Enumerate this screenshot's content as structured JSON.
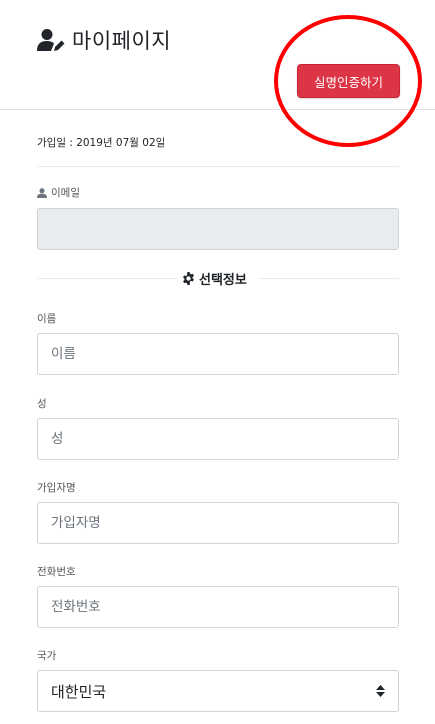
{
  "header": {
    "title": "마이페이지",
    "verify_button_label": "실명인증하기",
    "accent_color": "#dc3545",
    "highlight_color": "#ff0000"
  },
  "account": {
    "join_date": "가입일 : 2019년 07월 02일",
    "email_label": "이메일",
    "email_value": ""
  },
  "optional_section": {
    "title": "선택정보",
    "fields": {
      "first_name": {
        "label": "이름",
        "placeholder": "이름"
      },
      "last_name": {
        "label": "성",
        "placeholder": "성"
      },
      "subscriber_name": {
        "label": "가입자명",
        "placeholder": "가입자명"
      },
      "phone": {
        "label": "전화번호",
        "placeholder": "전화번호"
      },
      "country": {
        "label": "국가",
        "selected": "대한민국"
      }
    }
  },
  "icons": {
    "title_icon": "user-edit-icon",
    "email_icon": "user-icon",
    "section_icon": "gear-icon",
    "select_icon": "sort-icon"
  }
}
